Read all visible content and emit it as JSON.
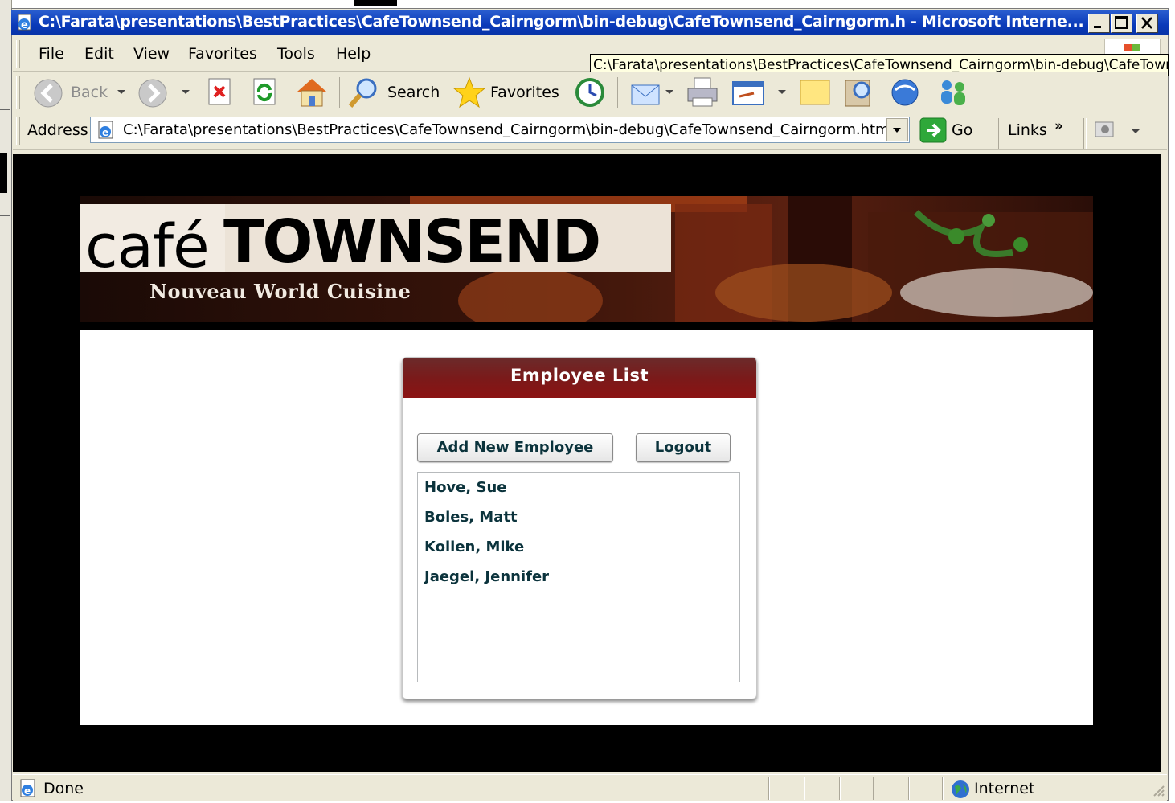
{
  "window": {
    "title": "C:\\Farata\\presentations\\BestPractices\\CafeTownsend_Cairngorm\\bin-debug\\CafeTownsend_Cairngorm.h - Microsoft Interne..."
  },
  "menu": {
    "items": [
      {
        "label": "File"
      },
      {
        "label": "Edit"
      },
      {
        "label": "View"
      },
      {
        "label": "Favorites"
      },
      {
        "label": "Tools"
      },
      {
        "label": "Help"
      }
    ]
  },
  "tooltip": "C:\\Farata\\presentations\\BestPractices\\CafeTownsend_Cairngorm\\bin-debug\\CafeTownsend_Cairngorm.html",
  "toolbar": {
    "back_label": "Back",
    "search_label": "Search",
    "favorites_label": "Favorites"
  },
  "address": {
    "label": "Address",
    "url": "C:\\Farata\\presentations\\BestPractices\\CafeTownsend_Cairngorm\\bin-debug\\CafeTownsend_Cairngorm.html",
    "go_label": "Go",
    "links_label": "Links",
    "links_chevron": "»"
  },
  "banner": {
    "cafe": "café",
    "townsend": "TOWNSEND",
    "tagline": "Nouveau World Cuisine"
  },
  "panel": {
    "title": "Employee List",
    "add_button": "Add New Employee",
    "logout_button": "Logout",
    "employees": [
      "Hove, Sue",
      "Boles, Matt",
      "Kollen, Mike",
      "Jaegel, Jennifer"
    ]
  },
  "status": {
    "text": "Done",
    "zone": "Internet"
  },
  "colors": {
    "titlebar": "#0a3ab9",
    "panel_header": "#7a1a1a",
    "list_text": "#0b333c"
  }
}
